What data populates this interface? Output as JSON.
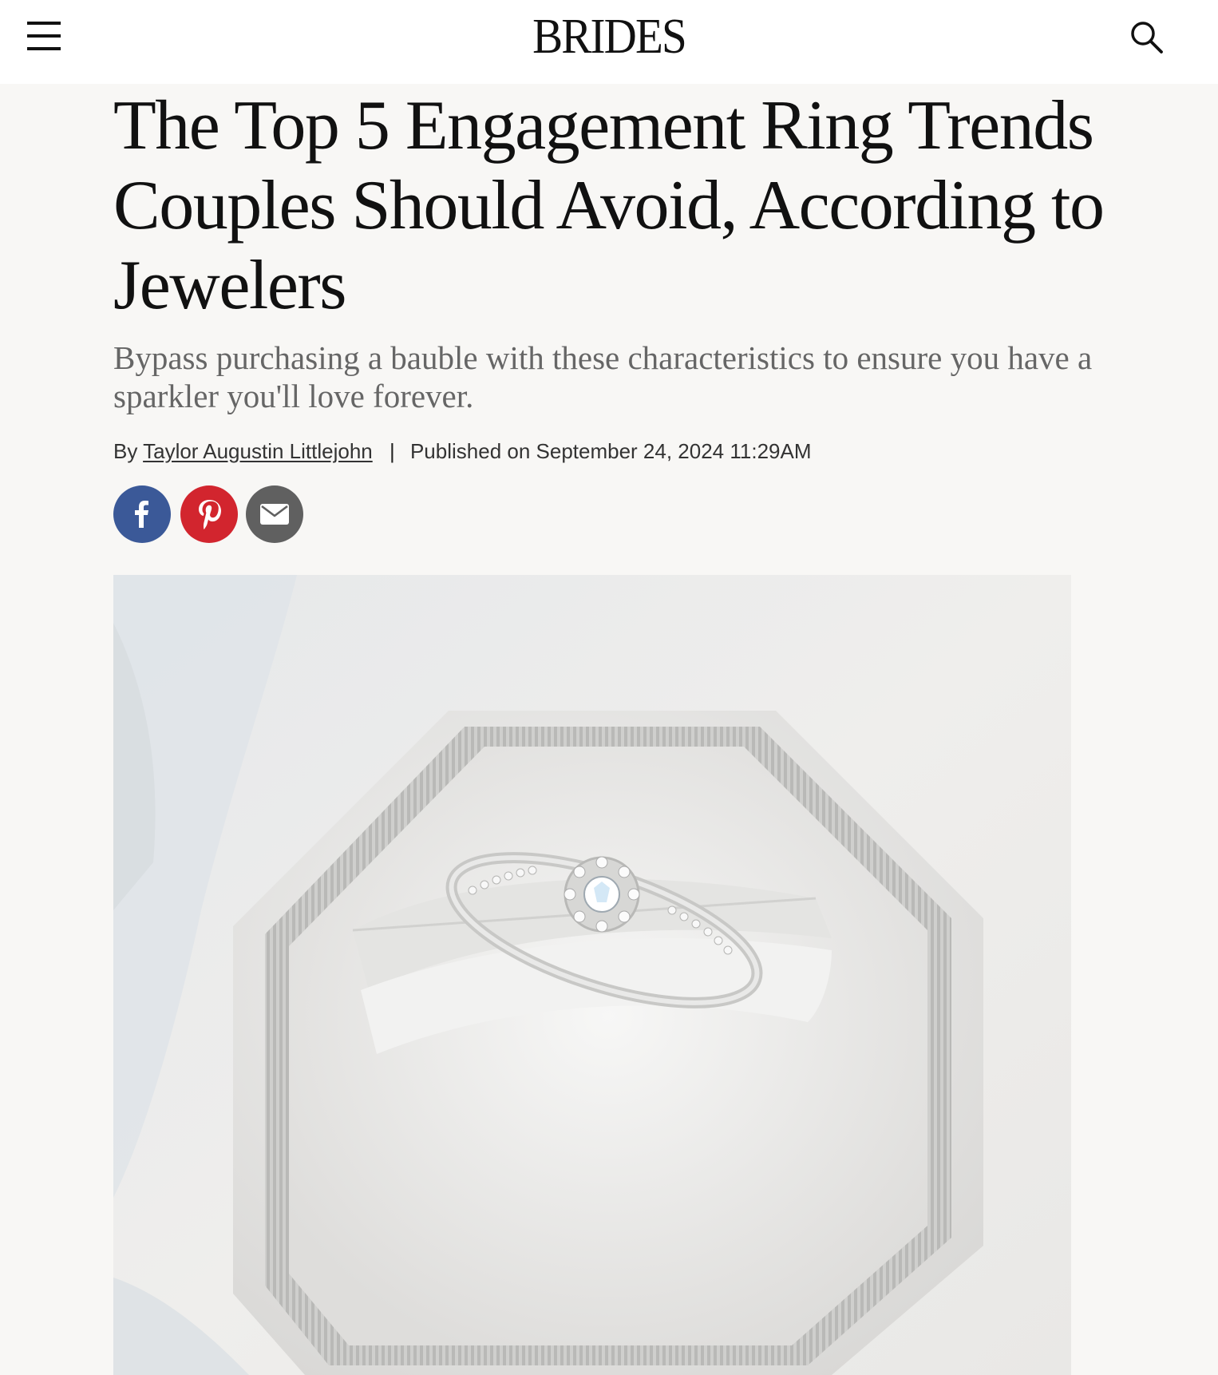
{
  "header": {
    "brand": "BRIDES",
    "menu_icon": "hamburger-menu-icon",
    "search_icon": "search-icon"
  },
  "article": {
    "headline": "The Top 5 Engagement Ring Trends Couples Should Avoid, According to Jewelers",
    "dek": "Bypass purchasing a bauble with these characteristics to ensure you have a sparkler you'll love forever.",
    "byline_prefix": "By",
    "author": "Taylor Augustin Littlejohn",
    "separator": "|",
    "published": "Published on September 24, 2024 11:29AM"
  },
  "share": {
    "facebook_icon": "facebook-icon",
    "pinterest_icon": "pinterest-icon",
    "email_icon": "email-icon"
  },
  "colors": {
    "facebook": "#3b5998",
    "pinterest": "#d2252e",
    "email": "#606060",
    "page_background": "#f8f7f5"
  }
}
